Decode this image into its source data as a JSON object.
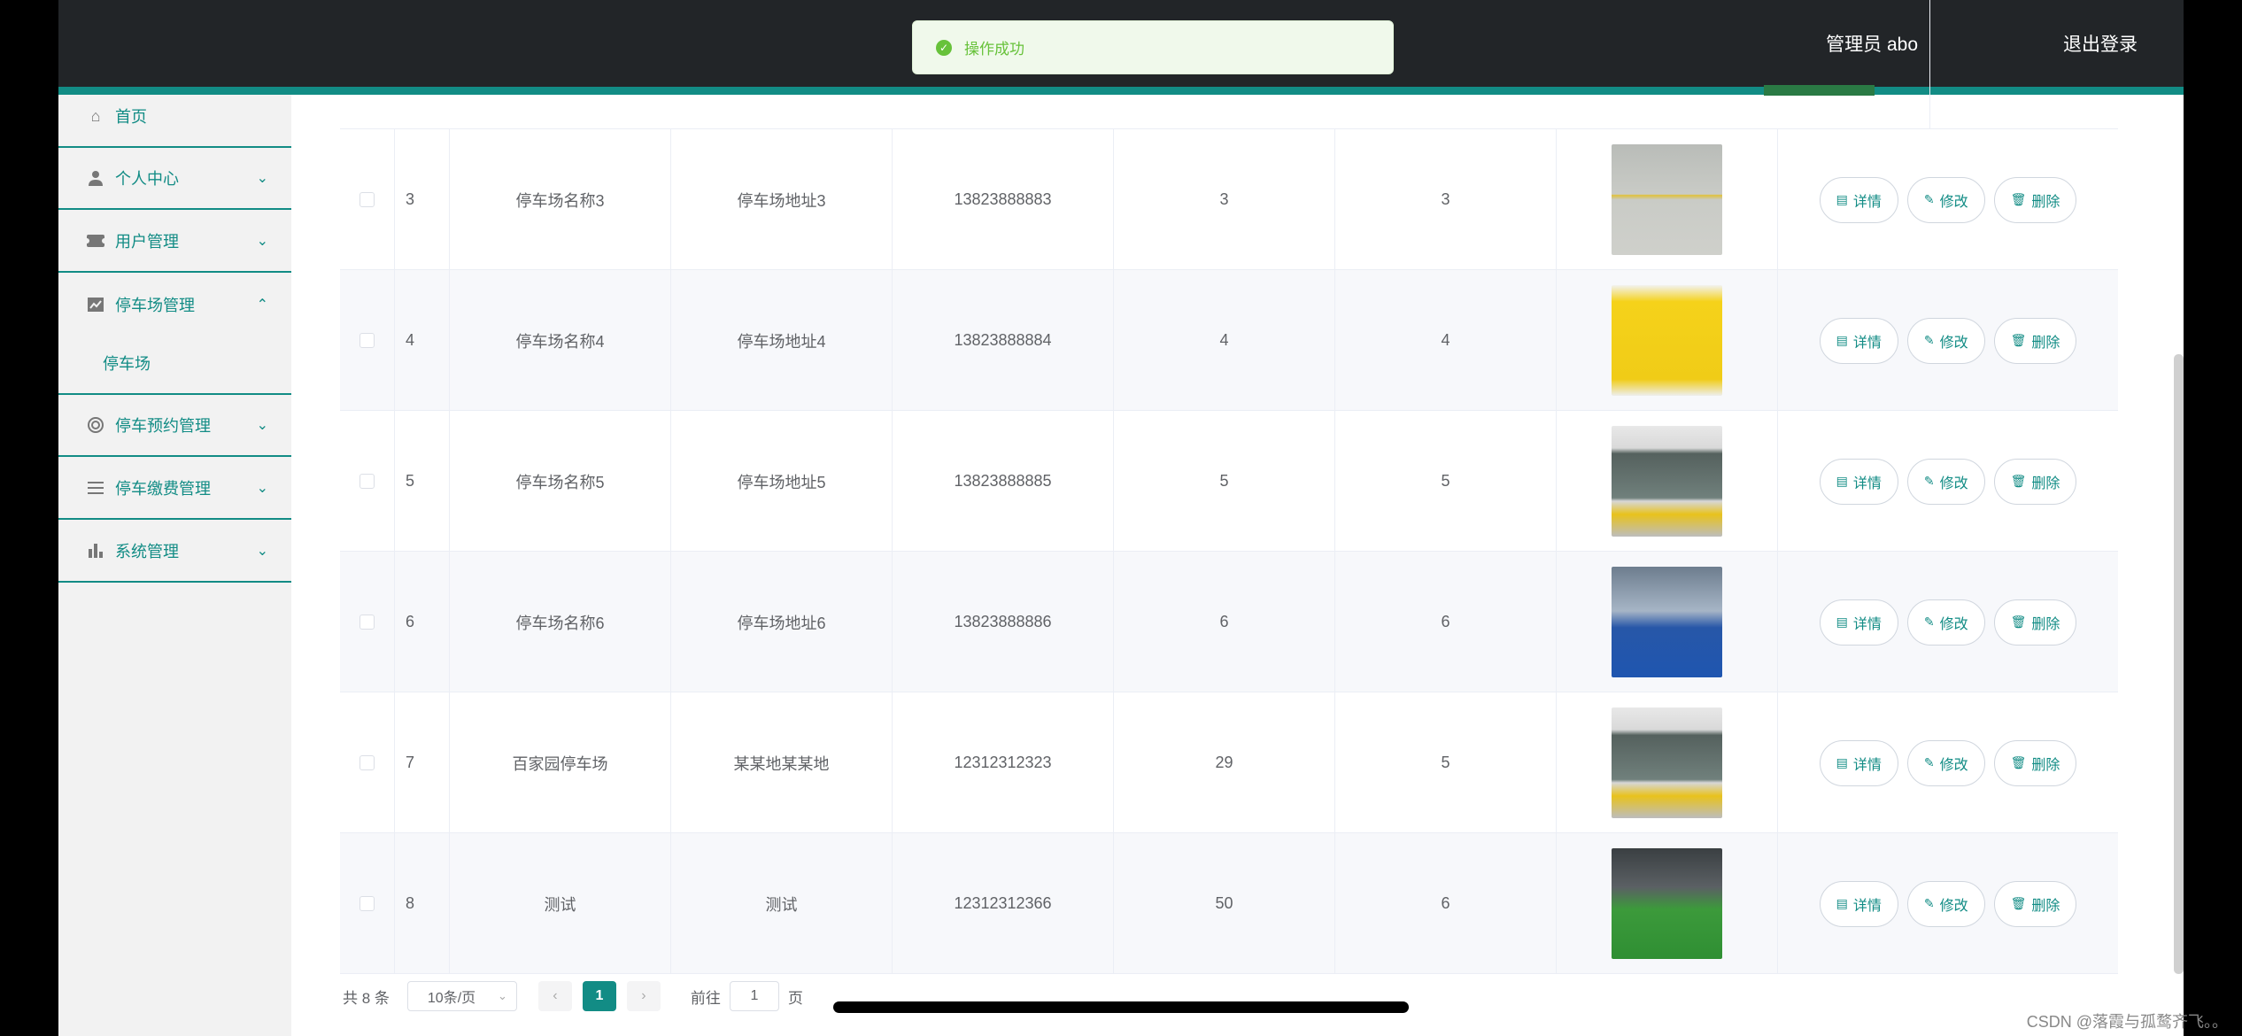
{
  "header": {
    "user_label": "管理员 abo",
    "logout_label": "退出登录"
  },
  "toast": {
    "message": "操作成功",
    "icon": "check-circle-icon",
    "color": "#67c23a"
  },
  "sidebar": {
    "items": [
      {
        "label": "首页",
        "icon": "home-icon"
      },
      {
        "label": "个人中心",
        "icon": "person-icon"
      },
      {
        "label": "用户管理",
        "icon": "ticket-icon"
      },
      {
        "label": "停车场管理",
        "icon": "chart-icon"
      },
      {
        "label": "停车预约管理",
        "icon": "lifebuoy-icon"
      },
      {
        "label": "停车缴费管理",
        "icon": "list-icon"
      },
      {
        "label": "系统管理",
        "icon": "bar-chart-icon"
      }
    ],
    "sub_items": {
      "parking": "停车场"
    },
    "accent": "#128c85"
  },
  "table": {
    "rows": [
      {
        "no": "3",
        "name": "停车场名称3",
        "address": "停车场地址3",
        "phone": "13823888883",
        "col5": "3",
        "col6": "3",
        "photo": "parking-lot-yellow-lines"
      },
      {
        "no": "4",
        "name": "停车场名称4",
        "address": "停车场地址4",
        "phone": "13823888884",
        "col5": "4",
        "col6": "4",
        "photo": "reserved-parking-sign"
      },
      {
        "no": "5",
        "name": "停车场名称5",
        "address": "停车场地址5",
        "phone": "13823888885",
        "col5": "5",
        "col6": "5",
        "photo": "garage-entrance"
      },
      {
        "no": "6",
        "name": "停车场名称6",
        "address": "停车场地址6",
        "phone": "13823888886",
        "col5": "6",
        "col6": "6",
        "photo": "blue-parking-space"
      },
      {
        "no": "7",
        "name": "百家园停车场",
        "address": "某某地某某地",
        "phone": "12312312323",
        "col5": "29",
        "col6": "5",
        "photo": "garage-entrance"
      },
      {
        "no": "8",
        "name": "测试",
        "address": "测试",
        "phone": "12312312366",
        "col5": "50",
        "col6": "6",
        "photo": "green-parking-space"
      }
    ],
    "actions": {
      "detail": "详情",
      "edit": "修改",
      "delete": "删除"
    }
  },
  "pagination": {
    "total": "共 8 条",
    "page_size": "10条/页",
    "current_page": "1",
    "goto_prefix": "前往",
    "goto_value": "1",
    "goto_suffix": "页"
  },
  "watermark": "CSDN @落霞与孤鹜齐飞。。"
}
